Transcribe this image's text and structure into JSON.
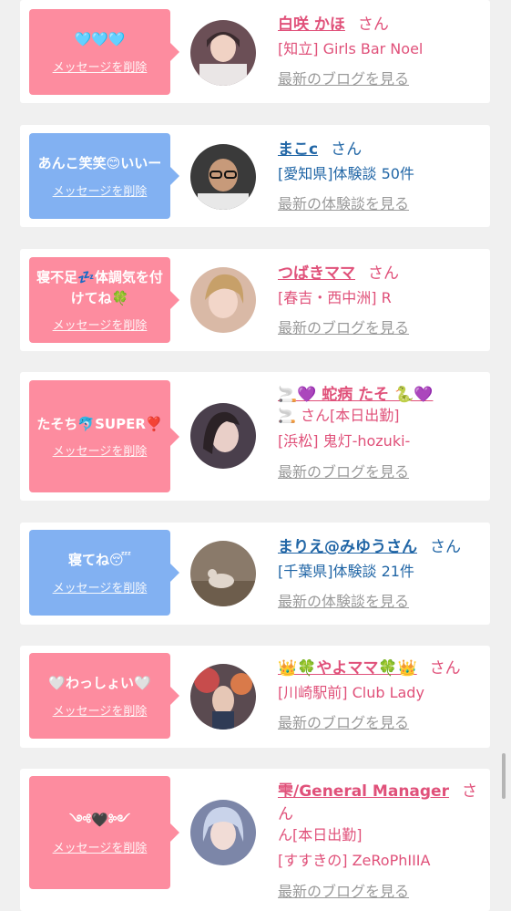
{
  "delete_label": "メッセージを削除",
  "suffix": "さん",
  "cards": [
    {
      "message": "🩵🩵🩵",
      "name": "白咲 かほ",
      "line1": "",
      "line2": "[知立] Girls Bar Noel",
      "more": "最新のブログを見る"
    },
    {
      "message": "あんこ笑笑😊いいー",
      "name": "まこc",
      "line1": "",
      "line2": "[愛知県]体験談 50件",
      "more": "最新の体験談を見る"
    },
    {
      "message": "寝不足💤体調気を付けてね🍀",
      "name": "つばきママ",
      "line1": "",
      "line2": "[春吉・西中洲] R",
      "more": "最新のブログを見る"
    },
    {
      "message": "たそち🐬SUPER❣️",
      "name": "🚬💜 蛇病 たそ 🐍💜",
      "line1": "🚬 さん[本日出勤]",
      "line2": "[浜松] 鬼灯-hozuki-",
      "more": "最新のブログを見る"
    },
    {
      "message": "寝てね😴",
      "name": "まりえ@みゆうさん",
      "line1": "",
      "line2": "[千葉県]体験談 21件",
      "more": "最新の体験談を見る"
    },
    {
      "message": "🤍わっしょい🤍",
      "name": "👑🍀やよママ🍀👑",
      "line1": "",
      "line2": "[川崎駅前] Club Lady",
      "more": "最新のブログを見る"
    },
    {
      "message": "༺🖤༻",
      "name": "雫/General Manager",
      "line1": "ん[本日出勤]",
      "line2": "[すすきの] ZeRoPhIIIA",
      "more": "最新のブログを見る"
    }
  ]
}
